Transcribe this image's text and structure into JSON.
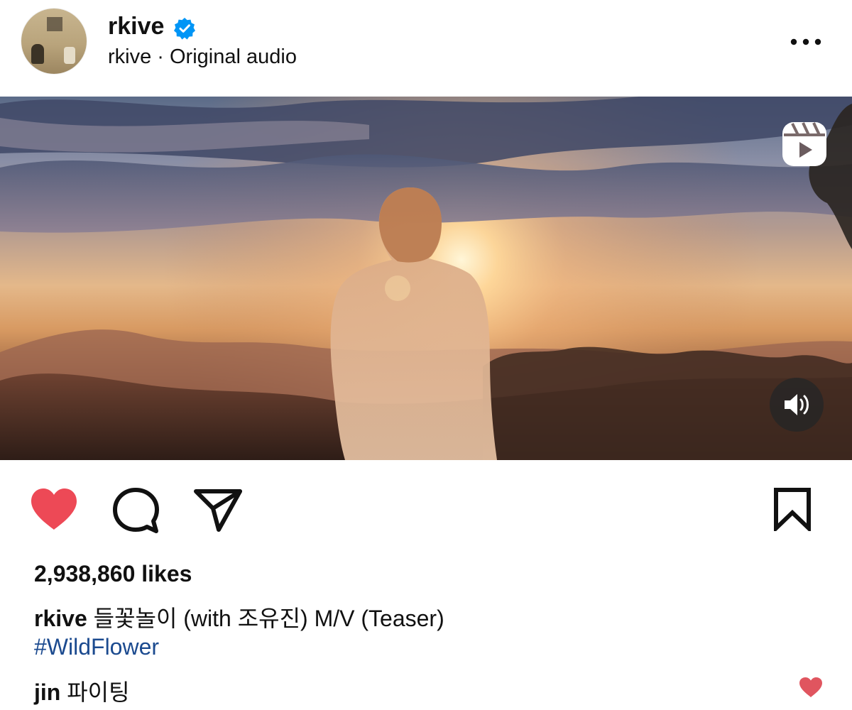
{
  "post": {
    "username": "rkive",
    "verified": true,
    "subtitle": "rkive · Original audio",
    "more_icon": "more-horizontal-icon"
  },
  "media": {
    "type": "reel",
    "reels_icon": "reels-icon",
    "audio_icon": "speaker-on-icon"
  },
  "actions": {
    "like_icon": "heart-filled-icon",
    "liked": true,
    "comment_icon": "comment-icon",
    "share_icon": "send-icon",
    "save_icon": "bookmark-icon"
  },
  "likes_text": "2,938,860 likes",
  "caption": {
    "username": "rkive",
    "text": "들꽃놀이 (with 조유진) M/V (Teaser)",
    "hashtag": "#WildFlower"
  },
  "comment": {
    "username": "jin",
    "text": "파이팅",
    "like_icon": "heart-filled-small-icon"
  },
  "colors": {
    "like_red": "#ed4956",
    "verified_blue": "#0095f6",
    "hashtag_blue": "#1b4a8f",
    "comment_like_red": "#e0555f"
  }
}
